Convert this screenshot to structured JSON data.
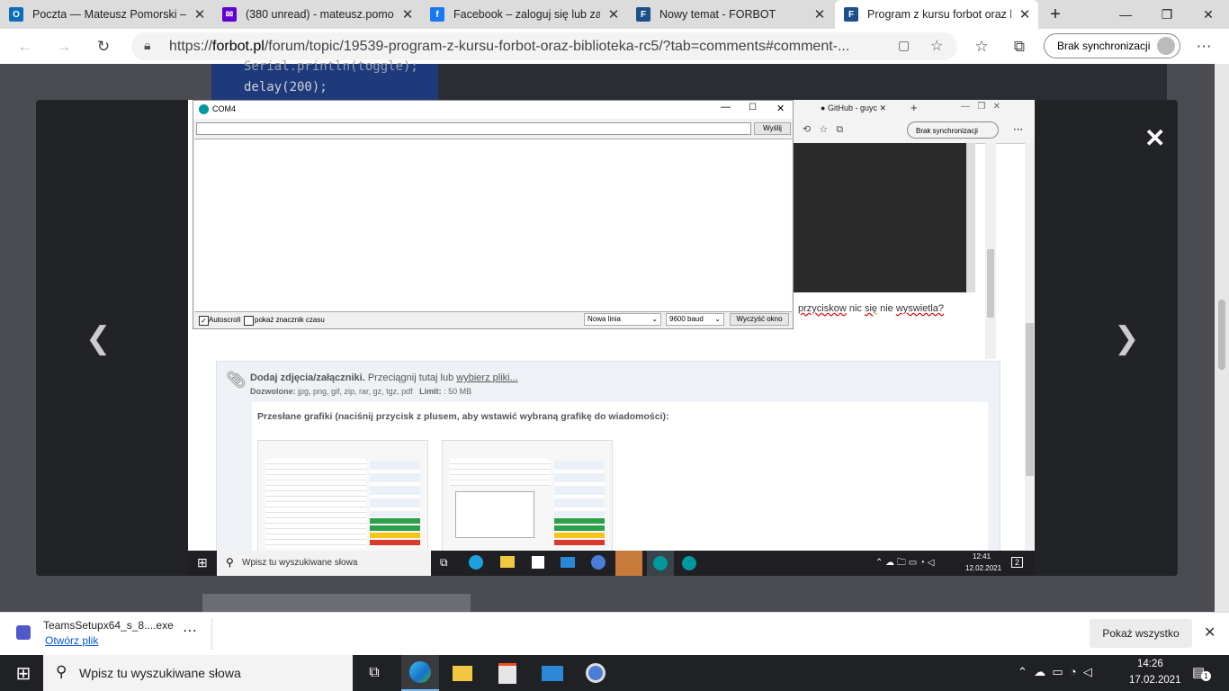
{
  "browser": {
    "tabs": [
      {
        "title": "Poczta — Mateusz Pomorski — Ou",
        "icon": "outlook-icon",
        "color": "#0a6ebd"
      },
      {
        "title": "(380 unread) - mateusz.pomorski",
        "icon": "yahoo-mail-icon",
        "color": "#6001d2"
      },
      {
        "title": "Facebook – zaloguj się lub zarej",
        "icon": "facebook-icon",
        "color": "#1877f2"
      },
      {
        "title": "Nowy temat - FORBOT",
        "icon": "forbot-icon",
        "color": "#1c4f8c"
      },
      {
        "title": "Program z kursu forbot oraz bi",
        "icon": "forbot-icon",
        "color": "#1c4f8c"
      }
    ],
    "url_prefix": "https://",
    "url_host": "forbot.pl",
    "url_path": "/forum/topic/19539-program-z-kursu-forbot-oraz-biblioteka-rc5/?tab=comments#comment-...",
    "sync_label": "Brak synchronizacji"
  },
  "page": {
    "code_line1": "Serial.println(toggle);",
    "code_line2": "delay(200);"
  },
  "screenshot": {
    "serial_monitor": {
      "title": "COM4",
      "send_label": "Wyślij",
      "autoscroll_label": "Autoscroll",
      "timestamp_label": "pokaż znacznik czasu",
      "line_ending": "Nowa linia",
      "baud": "9600 baud",
      "clear_label": "Wyczyść okno"
    },
    "inner_tab_title": "GitHub - guyc",
    "inner_sync": "Brak synchronizacji",
    "post_text_1": "przyciskow",
    "post_text_2": "nic",
    "post_text_3": "się",
    "post_text_4": "nie",
    "post_text_5": "wyswietla?",
    "attach_title": "Dodaj zdjęcia/załączniki.",
    "attach_drag": "Przeciągnij tutaj lub",
    "attach_link": "wybierz pliki...",
    "allowed_label": "Dozwolone:",
    "allowed_types": "jpg, png, gif, zip, rar, gz, tgz, pdf",
    "limit_label": "Limit:",
    "limit_value": ": 50 MB",
    "uploaded_title": "Przesłane grafiki (naciśnij przycisk z plusem, aby wstawić wybraną grafikę do wiadomości):",
    "inner_search": "Wpisz tu wyszukiwane słowa",
    "inner_time": "12:41",
    "inner_date": "12.02.2021",
    "inner_notif": "2"
  },
  "download": {
    "filename": "TeamsSetupx64_s_8....exe",
    "open_label": "Otwórz plik",
    "show_all": "Pokaż wszystko"
  },
  "taskbar": {
    "search_placeholder": "Wpisz tu wyszukiwane słowa",
    "time": "14:26",
    "date": "17.02.2021",
    "notif_count": "1"
  }
}
